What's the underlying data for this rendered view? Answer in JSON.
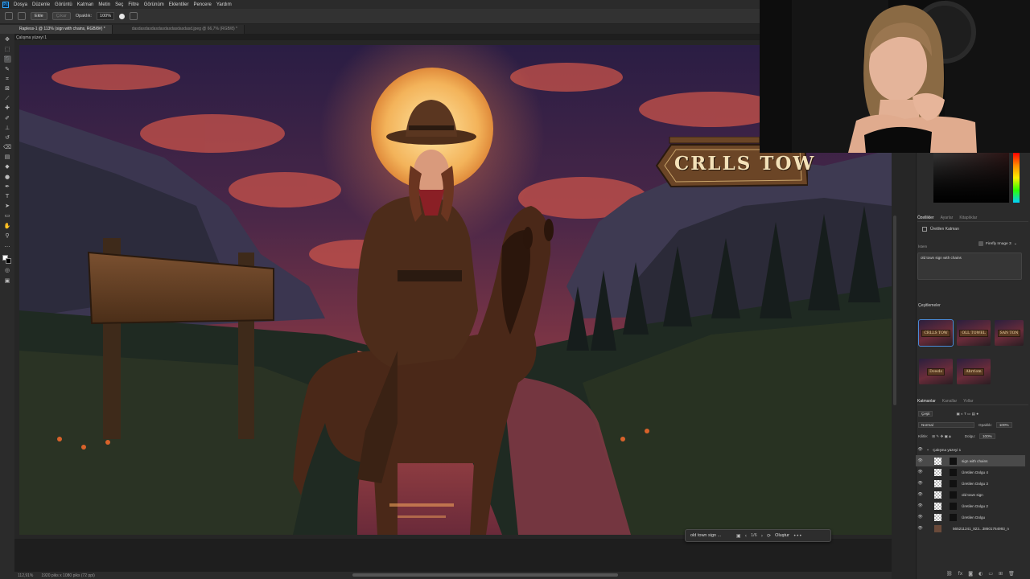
{
  "menu": [
    "Dosya",
    "Düzenle",
    "Görüntü",
    "Katman",
    "Metin",
    "Seç",
    "Filtre",
    "Görünüm",
    "Eklentiler",
    "Pencere",
    "Yardım"
  ],
  "options": {
    "mode_active": "Ekle",
    "mode_inactive": "Çıkar",
    "opacity_label": "Opaklık:",
    "opacity_value": "100%"
  },
  "tabs": [
    {
      "label": "Rapless-1 @ 113% (sign with chains, RGB/8#) *"
    },
    {
      "label": "dasdasdasdasdasdasdasdasdasd.jpeg @ 66,7% (RGB/8) *"
    }
  ],
  "artboard_label": "Çalışma yüzeyi 1",
  "artwork": {
    "sign_text": "CRLLS TOW"
  },
  "taskbar": {
    "prompt": "old town sign ...",
    "counter": "1/6",
    "generate": "Oluştur",
    "more": "•••"
  },
  "status": {
    "zoom": "112,91%",
    "size": "1920 piks x 1080 piks (72 ppi)"
  },
  "properties": {
    "tabs": [
      "Özellikler",
      "Ayarlar",
      "Kitaplıklar"
    ],
    "layer_type": "Üretilen Katman",
    "prompt_label": "İstem",
    "model": "Firefly Image 3",
    "prompt": "old town sign with chains",
    "variations_label": "Çeşitlemeler",
    "variations": [
      {
        "text": "CRLLS TOW"
      },
      {
        "text": "OLL TOWEL"
      },
      {
        "text": "SAN TON"
      },
      {
        "text": "Dowds"
      },
      {
        "text": "Ahrriom"
      }
    ]
  },
  "layers_panel": {
    "tabs": [
      "Katmanlar",
      "Kanallar",
      "Yollar"
    ],
    "filter": "Çeşit",
    "blend": "Normal",
    "opacity_label": "Opaklık:",
    "opacity": "100%",
    "lock_label": "Kilitle:",
    "fill_label": "Dolgu:",
    "fill": "100%",
    "group": "Çalışma yüzeyi 1",
    "items": [
      {
        "name": "sign with chains"
      },
      {
        "name": "Üretilen Dolgu 4"
      },
      {
        "name": "Üretilen Dolgu 3"
      },
      {
        "name": "old town sign"
      },
      {
        "name": "Üretilen Dolgu 2"
      },
      {
        "name": "Üretilen Dolgu"
      },
      {
        "name": "565211241_823...38601764993_n"
      }
    ]
  },
  "colors": {
    "accent": "#4b8bd8",
    "panel_bg": "#2b2b2b",
    "moon": "#f3b35a",
    "sky": "#3b2244"
  }
}
